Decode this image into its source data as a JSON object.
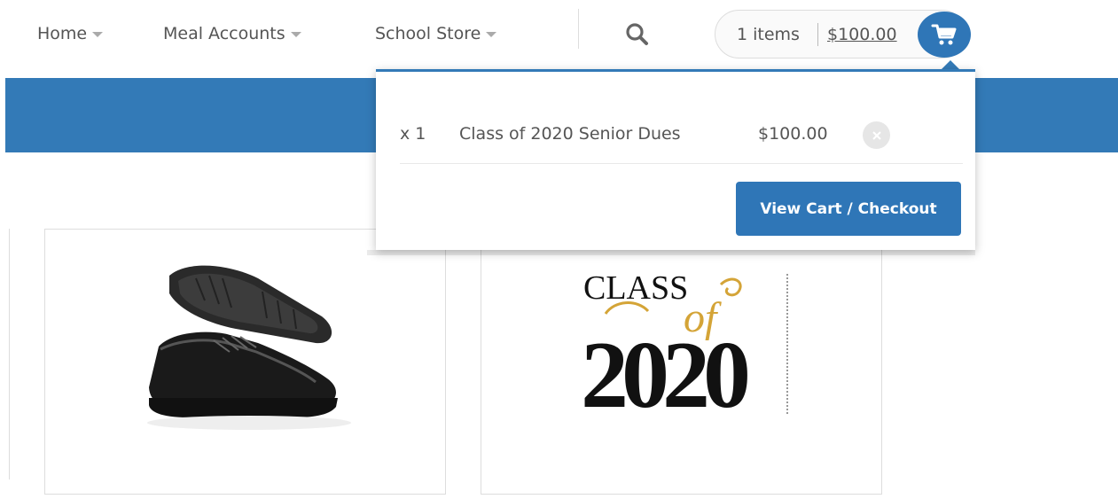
{
  "nav": {
    "items": [
      {
        "label": "Home"
      },
      {
        "label": "Meal Accounts"
      },
      {
        "label": "School Store"
      }
    ],
    "search_icon": "search-icon"
  },
  "cart": {
    "count_label": "1 items",
    "total": "$100.00",
    "icon": "shopping-cart-icon",
    "dropdown": {
      "items": [
        {
          "qty": "x 1",
          "name": "Class of 2020 Senior Dues",
          "price": "$100.00",
          "remove_icon": "close-icon"
        }
      ],
      "checkout_label": "View Cart / Checkout"
    }
  },
  "products": [
    {
      "image": "black-shoe"
    },
    {
      "image": "class-of-2020-graphic",
      "graphic_text": {
        "class": "CLASS",
        "of": "of",
        "year": "2020"
      }
    }
  ],
  "colors": {
    "accent": "#337ab7",
    "button": "#2f76b7",
    "gold": "#d4a437"
  }
}
